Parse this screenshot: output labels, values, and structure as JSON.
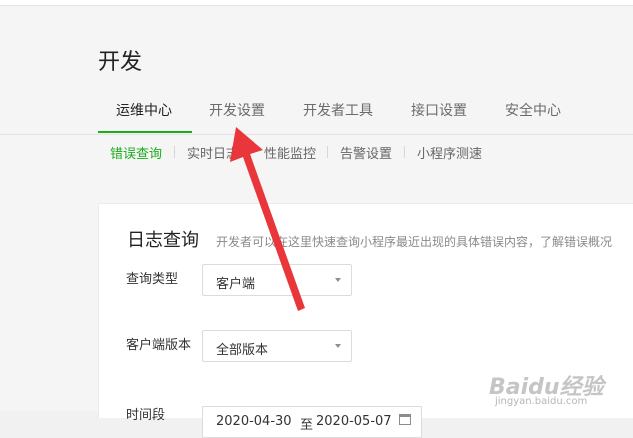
{
  "page": {
    "title": "开发"
  },
  "tabs": [
    {
      "label": "运维中心",
      "active": true
    },
    {
      "label": "开发设置",
      "active": false
    },
    {
      "label": "开发者工具",
      "active": false
    },
    {
      "label": "接口设置",
      "active": false
    },
    {
      "label": "安全中心",
      "active": false
    }
  ],
  "subnav": [
    {
      "label": "错误查询",
      "active": true
    },
    {
      "label": "实时日志",
      "active": false
    },
    {
      "label": "性能监控",
      "active": false
    },
    {
      "label": "告警设置",
      "active": false
    },
    {
      "label": "小程序测速",
      "active": false
    }
  ],
  "log_query": {
    "title": "日志查询",
    "description": "开发者可以在这里快速查询小程序最近出现的具体错误内容，了解错误概况",
    "query_type": {
      "label": "查询类型",
      "value": "客户端"
    },
    "client_version": {
      "label": "客户端版本",
      "value": "全部版本"
    },
    "time_range": {
      "label": "时间段",
      "start": "2020-04-30",
      "to": "至",
      "end": "2020-05-07"
    }
  },
  "annotation": {
    "color": "#e8363a",
    "icon": "red-arrow-icon"
  },
  "watermark": {
    "brand": "Baidu经验",
    "url": "jingyan.baidu.com"
  },
  "colors": {
    "accent": "#1aad19"
  }
}
